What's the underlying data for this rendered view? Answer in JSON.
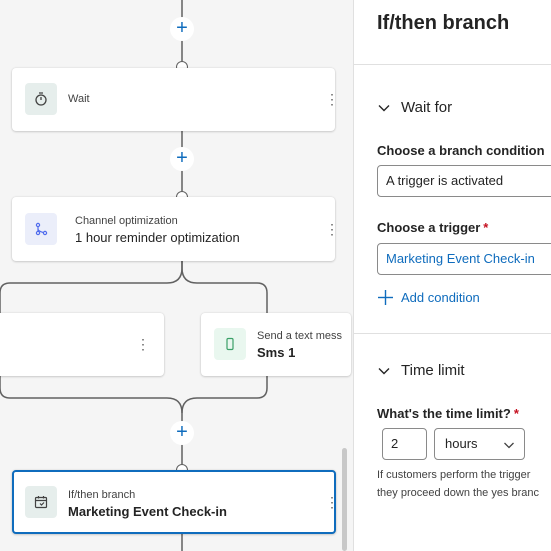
{
  "canvas": {
    "wait_card": {
      "title": "Wait",
      "icon": "timer-icon"
    },
    "channel_card": {
      "label": "Channel optimization",
      "title": "1 hour reminder optimization",
      "icon": "branch-icon"
    },
    "sms_card": {
      "label": "Send a text mess",
      "title": "Sms 1",
      "icon": "phone-icon"
    },
    "ifthen_card": {
      "label": "If/then branch",
      "title": "Marketing Event Check-in",
      "icon": "branch-calendar-icon"
    },
    "more_glyph": "⋮",
    "plus_glyph": "+"
  },
  "panel": {
    "title": "If/then branch",
    "wait_section": {
      "heading": "Wait for",
      "branch_condition_label": "Choose a branch condition",
      "branch_condition_value": "A trigger is activated",
      "trigger_label": "Choose a trigger",
      "trigger_required": "*",
      "trigger_value": "Marketing Event Check-in",
      "add_condition": "Add condition"
    },
    "time_section": {
      "heading": "Time limit",
      "time_limit_label": "What's the time limit?",
      "time_limit_required": "*",
      "amount": "2",
      "unit": "hours",
      "help_line1": "If customers perform the trigger",
      "help_line2": "they proceed down the yes branc"
    }
  },
  "colors": {
    "accent": "#0f6cbd",
    "required": "#c50f1f"
  }
}
